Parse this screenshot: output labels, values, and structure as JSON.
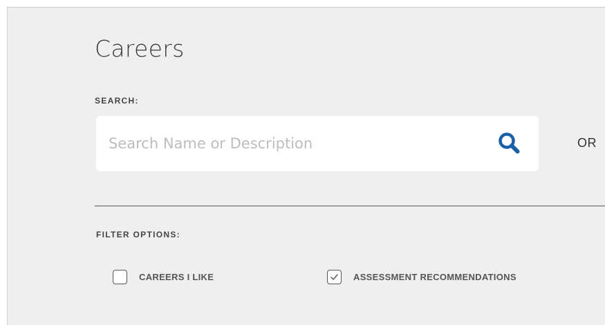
{
  "page": {
    "title": "Careers"
  },
  "search": {
    "label": "SEARCH:",
    "placeholder": "Search Name or Description",
    "value": "",
    "icon": "search-icon",
    "icon_color": "#1a5fa8"
  },
  "or_text": "OR",
  "filters": {
    "label": "FILTER OPTIONS:",
    "options": [
      {
        "label": "CAREERS I LIKE",
        "checked": false
      },
      {
        "label": "ASSESSMENT RECOMMENDATIONS",
        "checked": true
      }
    ]
  },
  "colors": {
    "background": "#efefef",
    "input_background": "#ffffff",
    "text": "#3a3a3a",
    "accent": "#1a5fa8"
  }
}
